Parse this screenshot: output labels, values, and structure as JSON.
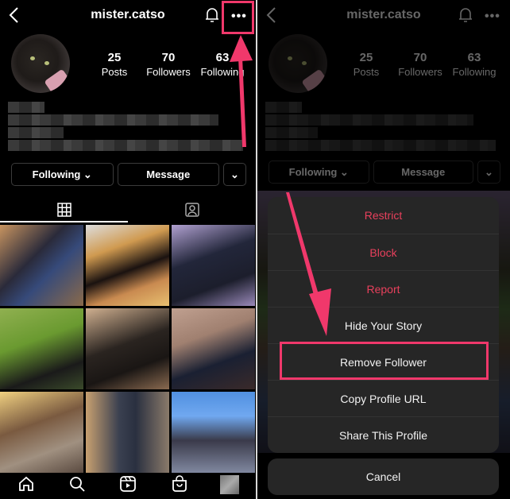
{
  "accent_color": "#f0386b",
  "profile": {
    "username": "mister.catso",
    "stats": [
      {
        "value": "25",
        "label": "Posts"
      },
      {
        "value": "70",
        "label": "Followers"
      },
      {
        "value": "63",
        "label": "Following"
      }
    ],
    "buttons": {
      "following": "Following ⌄",
      "message": "Message",
      "more": "⌄"
    },
    "more_menu_icon": "•••",
    "tabs": [
      "grid-icon",
      "tagged-icon"
    ],
    "bottom_nav": [
      "home-icon",
      "search-icon",
      "reels-icon",
      "shop-icon",
      "profile-icon"
    ]
  },
  "action_sheet": {
    "items": [
      {
        "label": "Restrict",
        "style": "danger"
      },
      {
        "label": "Block",
        "style": "danger"
      },
      {
        "label": "Report",
        "style": "danger"
      },
      {
        "label": "Hide Your Story",
        "style": "normal"
      },
      {
        "label": "Remove Follower",
        "style": "normal",
        "highlighted": true
      },
      {
        "label": "Copy Profile URL",
        "style": "normal"
      },
      {
        "label": "Share This Profile",
        "style": "normal"
      }
    ],
    "cancel": "Cancel"
  }
}
